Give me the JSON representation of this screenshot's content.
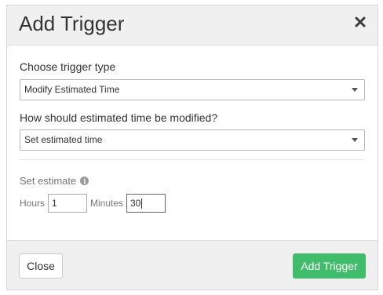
{
  "dialog": {
    "title": "Add Trigger",
    "close_icon": "close-icon"
  },
  "trigger_type": {
    "label": "Choose trigger type",
    "selected": "Modify Estimated Time"
  },
  "modification": {
    "label": "How should estimated time be modified?",
    "selected": "Set estimated time"
  },
  "estimate": {
    "label": "Set estimate",
    "info_icon": "info-icon",
    "hours_label": "Hours",
    "hours_value": "1",
    "minutes_label": "Minutes",
    "minutes_value": "30"
  },
  "footer": {
    "close_label": "Close",
    "submit_label": "Add Trigger"
  },
  "colors": {
    "primary_button": "#3fbd6b",
    "header_background": "#f0f0f0"
  }
}
